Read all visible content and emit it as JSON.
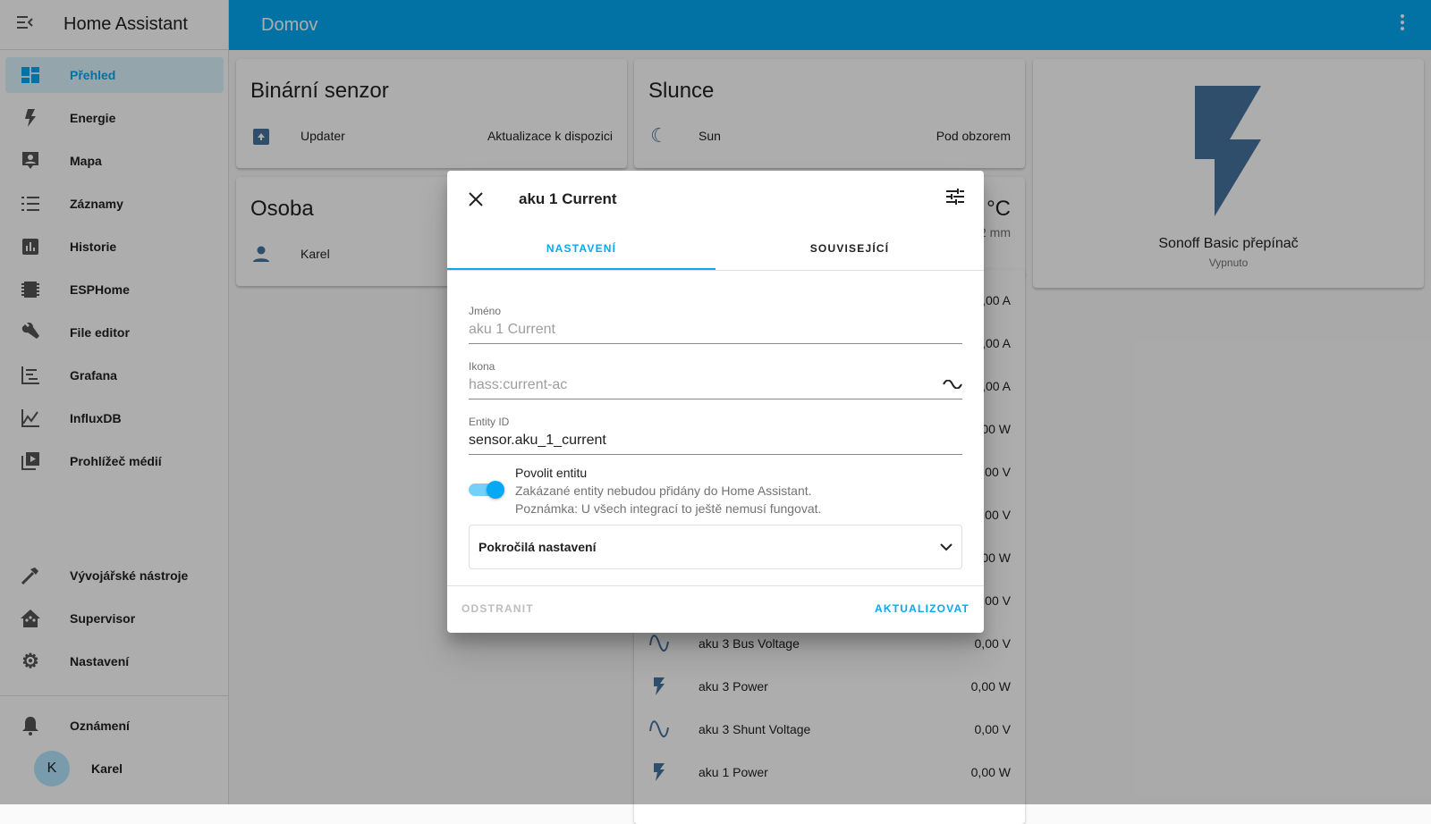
{
  "app": {
    "title": "Home Assistant",
    "page_title": "Domov"
  },
  "colors": {
    "primary": "#03a9f4",
    "state_icon": "#44739e"
  },
  "sidebar": {
    "items": [
      {
        "label": "Přehled",
        "icon": "dashboard-icon",
        "selected": true
      },
      {
        "label": "Energie",
        "icon": "lightning-bolt-icon"
      },
      {
        "label": "Mapa",
        "icon": "map-account-icon"
      },
      {
        "label": "Záznamy",
        "icon": "format-list-icon"
      },
      {
        "label": "Historie",
        "icon": "chart-box-icon"
      },
      {
        "label": "ESPHome",
        "icon": "chip-icon"
      },
      {
        "label": "File editor",
        "icon": "wrench-icon"
      },
      {
        "label": "Grafana",
        "icon": "chart-timeline-icon"
      },
      {
        "label": "InfluxDB",
        "icon": "chart-areaspline-icon"
      },
      {
        "label": "Prohlížeč médií",
        "icon": "play-box-multiple-icon"
      }
    ],
    "bottom": [
      {
        "label": "Vývojářské nástroje",
        "icon": "hammer-icon"
      },
      {
        "label": "Supervisor",
        "icon": "home-assistant-icon"
      },
      {
        "label": "Nastavení",
        "icon": "cog-icon"
      }
    ],
    "notifications": "Oznámení",
    "user": {
      "name": "Karel",
      "initial": "K"
    }
  },
  "cards": {
    "binary": {
      "title": "Binární senzor",
      "rows": [
        {
          "name": "Updater",
          "value": "Aktualizace k dispozici"
        }
      ]
    },
    "person": {
      "title": "Osoba",
      "rows": [
        {
          "name": "Karel"
        }
      ]
    },
    "sun": {
      "title": "Slunce",
      "rows": [
        {
          "name": "Sun",
          "value": "Pod obzorem"
        }
      ]
    },
    "weather": {
      "unit": "°C",
      "precip": "2 mm"
    },
    "entities": {
      "rows": [
        {
          "name": "",
          "value": ",00 A"
        },
        {
          "name": "",
          "value": ",00 A"
        },
        {
          "name": "",
          "value": ",00 A"
        },
        {
          "name": "",
          "value": "00 W"
        },
        {
          "name": "",
          "value": ",00 V"
        },
        {
          "name": "",
          "value": ",00 V"
        },
        {
          "name": "",
          "value": "00 W"
        },
        {
          "name": "",
          "value": ",00 V"
        },
        {
          "name": "aku 3 Bus Voltage",
          "value": "0,00 V",
          "icon": "sine-wave-icon"
        },
        {
          "name": "aku 3 Power",
          "value": "0,00 W",
          "icon": "flash-icon"
        },
        {
          "name": "aku 3 Shunt Voltage",
          "value": "0,00 V",
          "icon": "sine-wave-icon"
        },
        {
          "name": "aku 1 Power",
          "value": "0,00 W",
          "icon": "flash-icon"
        }
      ]
    },
    "switch": {
      "name": "Sonoff Basic přepínač",
      "state": "Vypnuto"
    }
  },
  "dialog": {
    "title": "aku 1 Current",
    "tabs": [
      "NASTAVENÍ",
      "SOUVISEJÍCÍ"
    ],
    "name_label": "Jméno",
    "name_placeholder": "aku 1 Current",
    "icon_label": "Ikona",
    "icon_placeholder": "hass:current-ac",
    "entity_label": "Entity ID",
    "entity_value": "sensor.aku_1_current",
    "enable_label": "Povolit entitu",
    "enabled": true,
    "enable_help1": "Zakázané entity nebudou přidány do Home Assistant.",
    "enable_help2": "Poznámka: U všech integrací to ještě nemusí fungovat.",
    "advanced": "Pokročilá nastavení",
    "delete": "ODSTRANIT",
    "update": "AKTUALIZOVAT"
  }
}
